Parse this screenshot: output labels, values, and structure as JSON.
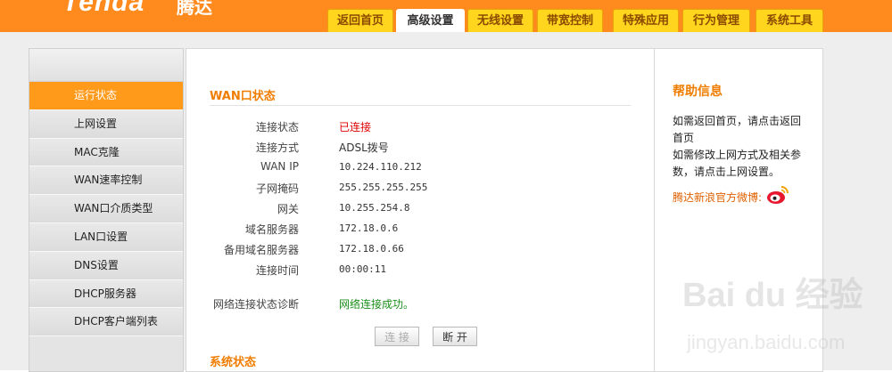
{
  "header": {
    "logo_text": "Tenda",
    "logo_cn": "腾达",
    "tabs": [
      {
        "label": "返回首页"
      },
      {
        "label": "高级设置"
      },
      {
        "label": "无线设置"
      },
      {
        "label": "带宽控制"
      },
      {
        "label": "特殊应用"
      },
      {
        "label": "行为管理"
      },
      {
        "label": "系统工具"
      }
    ],
    "active_tab": "高级设置"
  },
  "sidebar": {
    "items": [
      {
        "label": "运行状态"
      },
      {
        "label": "上网设置"
      },
      {
        "label": "MAC克隆"
      },
      {
        "label": "WAN速率控制"
      },
      {
        "label": "WAN口介质类型"
      },
      {
        "label": "LAN口设置"
      },
      {
        "label": "DNS设置"
      },
      {
        "label": "DHCP服务器"
      },
      {
        "label": "DHCP客户端列表"
      }
    ],
    "active_item": "运行状态"
  },
  "wan_status": {
    "title": "WAN口状态",
    "rows": [
      {
        "label": "连接状态",
        "value": "已连接"
      },
      {
        "label": "连接方式",
        "value": "ADSL拨号"
      },
      {
        "label": "WAN IP",
        "value": "10.224.110.212"
      },
      {
        "label": "子网掩码",
        "value": "255.255.255.255"
      },
      {
        "label": "网关",
        "value": "10.255.254.8"
      },
      {
        "label": "域名服务器",
        "value": "172.18.0.6"
      },
      {
        "label": "备用域名服务器",
        "value": "172.18.0.66"
      },
      {
        "label": "连接时间",
        "value": "00:00:11"
      }
    ],
    "diagnosis_label": "网络连接状态诊断",
    "diagnosis_value": "网络连接成功。",
    "connect_button": "连 接",
    "disconnect_button": "断 开"
  },
  "system_status": {
    "title": "系统状态"
  },
  "help": {
    "title": "帮助信息",
    "text_line1": "如需返回首页，请点击返回首页",
    "text_line2": "如需修改上网方式及相关参数，请点击上网设置。",
    "weibo_label": "腾达新浪官方微博:"
  },
  "watermark": {
    "text": "Bai du 经验",
    "sub": "jingyan.baidu.com"
  },
  "colors": {
    "accent_orange": "#ff8a1e",
    "tab_yellow": "#ffd51e",
    "connected_red": "#e00000",
    "success_green": "#1a8f1a"
  }
}
